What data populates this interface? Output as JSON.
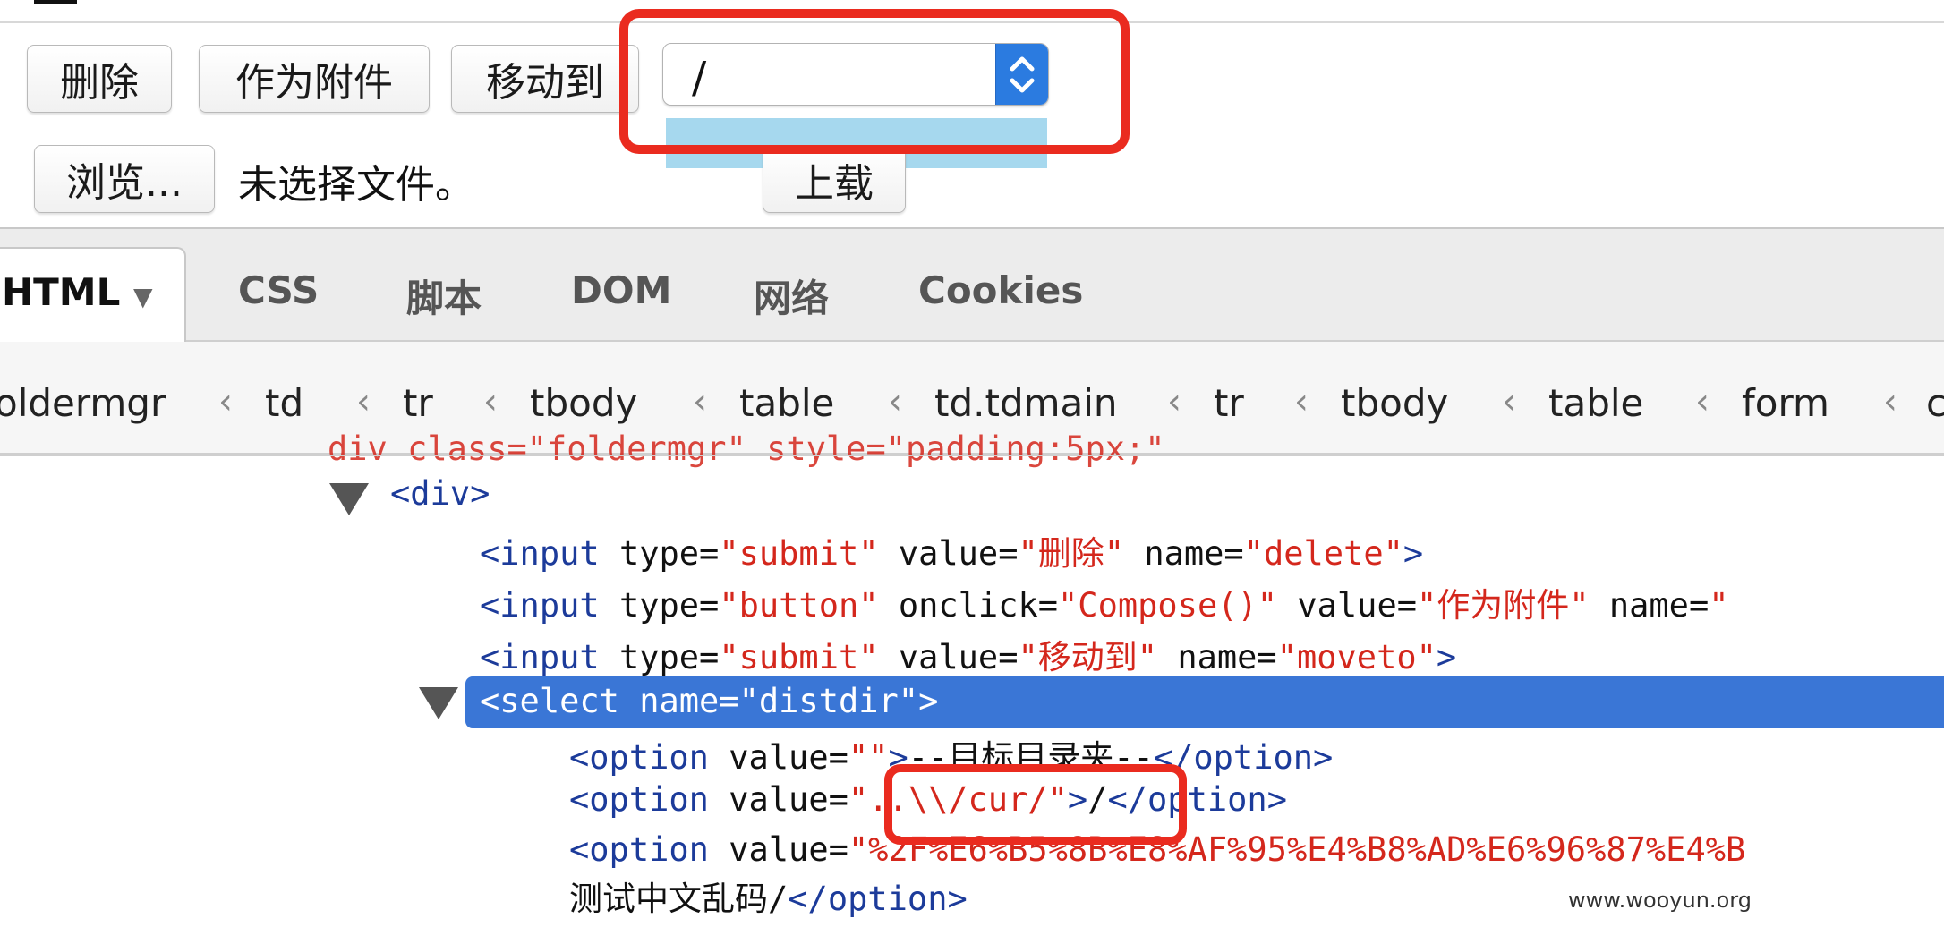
{
  "toolbar": {
    "delete_label": "删除",
    "attach_label": "作为附件",
    "moveto_label": "移动到",
    "select_value": "/"
  },
  "upload": {
    "browse_label": "浏览...",
    "no_file_text": "未选择文件。",
    "upload_label": "上载"
  },
  "devtools": {
    "tabs": [
      {
        "label": "HTML",
        "active": true
      },
      {
        "label": "CSS"
      },
      {
        "label": "脚本"
      },
      {
        "label": "DOM"
      },
      {
        "label": "网络"
      },
      {
        "label": "Cookies"
      }
    ],
    "breadcrumbs": [
      "oldermgr",
      "td",
      "tr",
      "tbody",
      "table",
      "td.tdmain",
      "tr",
      "tbody",
      "table",
      "form",
      "c"
    ],
    "code": {
      "partial_line": "div class=\"foldermgr\" style=\"padding:5px;\"",
      "div_open": "<div>",
      "line1": {
        "t1": "<input ",
        "a1": "type=",
        "v1": "\"submit\"",
        "a2": " value=",
        "v2": "\"删除\"",
        "a3": " name=",
        "v3": "\"delete\"",
        "t2": ">"
      },
      "line2": {
        "t1": "<input ",
        "a1": "type=",
        "v1": "\"button\"",
        "a2": " onclick=",
        "v2": "\"Compose()\"",
        "a3": " value=",
        "v3": "\"作为附件\"",
        "a4": " name=",
        "v4": "\""
      },
      "line3": {
        "t1": "<input ",
        "a1": "type=",
        "v1": "\"submit\"",
        "a2": " value=",
        "v2": "\"移动到\"",
        "a3": " name=",
        "v3": "\"moveto\"",
        "t2": ">"
      },
      "select_line": "<select name=\"distdir\">",
      "opt1": {
        "t1": "<option ",
        "a1": "value=",
        "v1": "\"\"",
        "t2": ">",
        "text": "--目标目录夹--",
        "t3": "</option>"
      },
      "opt2": {
        "t1": "<option ",
        "a1": "value=",
        "v1": "\"..\\\\/cur/\"",
        "t2": ">",
        "text": "/",
        "t3": "</option>"
      },
      "opt3": {
        "t1": "<option ",
        "a1": "value=",
        "v1": "\"%2F%E6%B5%8B%E8%AF%95%E4%B8%AD%E6%96%87%E4%B",
        "text": "测试中文乱码/",
        "t3": "</option>"
      }
    }
  },
  "watermark": "www.wooyun.org",
  "colors": {
    "highlight_red": "#ea2b1f",
    "selected_row": "#3a76d6",
    "select_arrow_bg": "#2b7be0"
  }
}
